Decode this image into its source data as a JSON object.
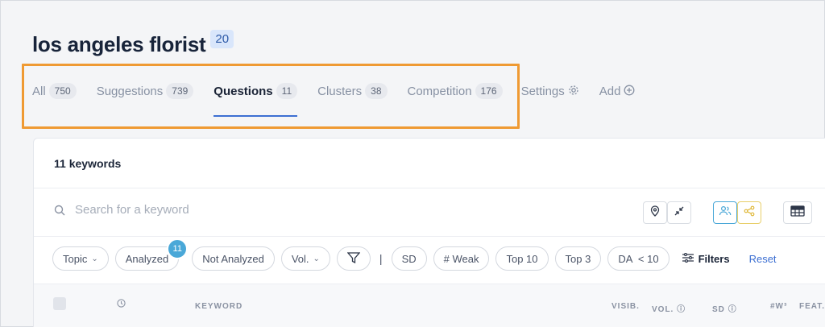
{
  "header": {
    "title": "los angeles florist",
    "count": "20"
  },
  "tabs": [
    {
      "label": "All",
      "count": "750"
    },
    {
      "label": "Suggestions",
      "count": "739"
    },
    {
      "label": "Questions",
      "count": "11"
    },
    {
      "label": "Clusters",
      "count": "38"
    },
    {
      "label": "Competition",
      "count": "176"
    },
    {
      "label": "Settings",
      "icon": "gear-icon"
    },
    {
      "label": "Add",
      "icon": "plus-circle-icon"
    }
  ],
  "active_tab": "Questions",
  "panel": {
    "keywords_count": "11 keywords",
    "search_placeholder": "Search for a keyword"
  },
  "filters": {
    "topic": "Topic",
    "analyzed": "Analyzed",
    "analyzed_badge": "11",
    "not_analyzed": "Not Analyzed",
    "vol": "Vol.",
    "sd": "SD",
    "weak": "# Weak",
    "top10": "Top 10",
    "top3": "Top 3",
    "da": "DA  < 10",
    "filters_label": "Filters",
    "reset_label": "Reset"
  },
  "table": {
    "columns": [
      "KEYWORD",
      "VISIB.",
      "VOL.",
      "SD",
      "#W³",
      "FEAT."
    ]
  },
  "colors": {
    "accent": "#3c6fd2",
    "highlight_border": "#ef9a33",
    "badge_blue": "#4aa8d8"
  }
}
